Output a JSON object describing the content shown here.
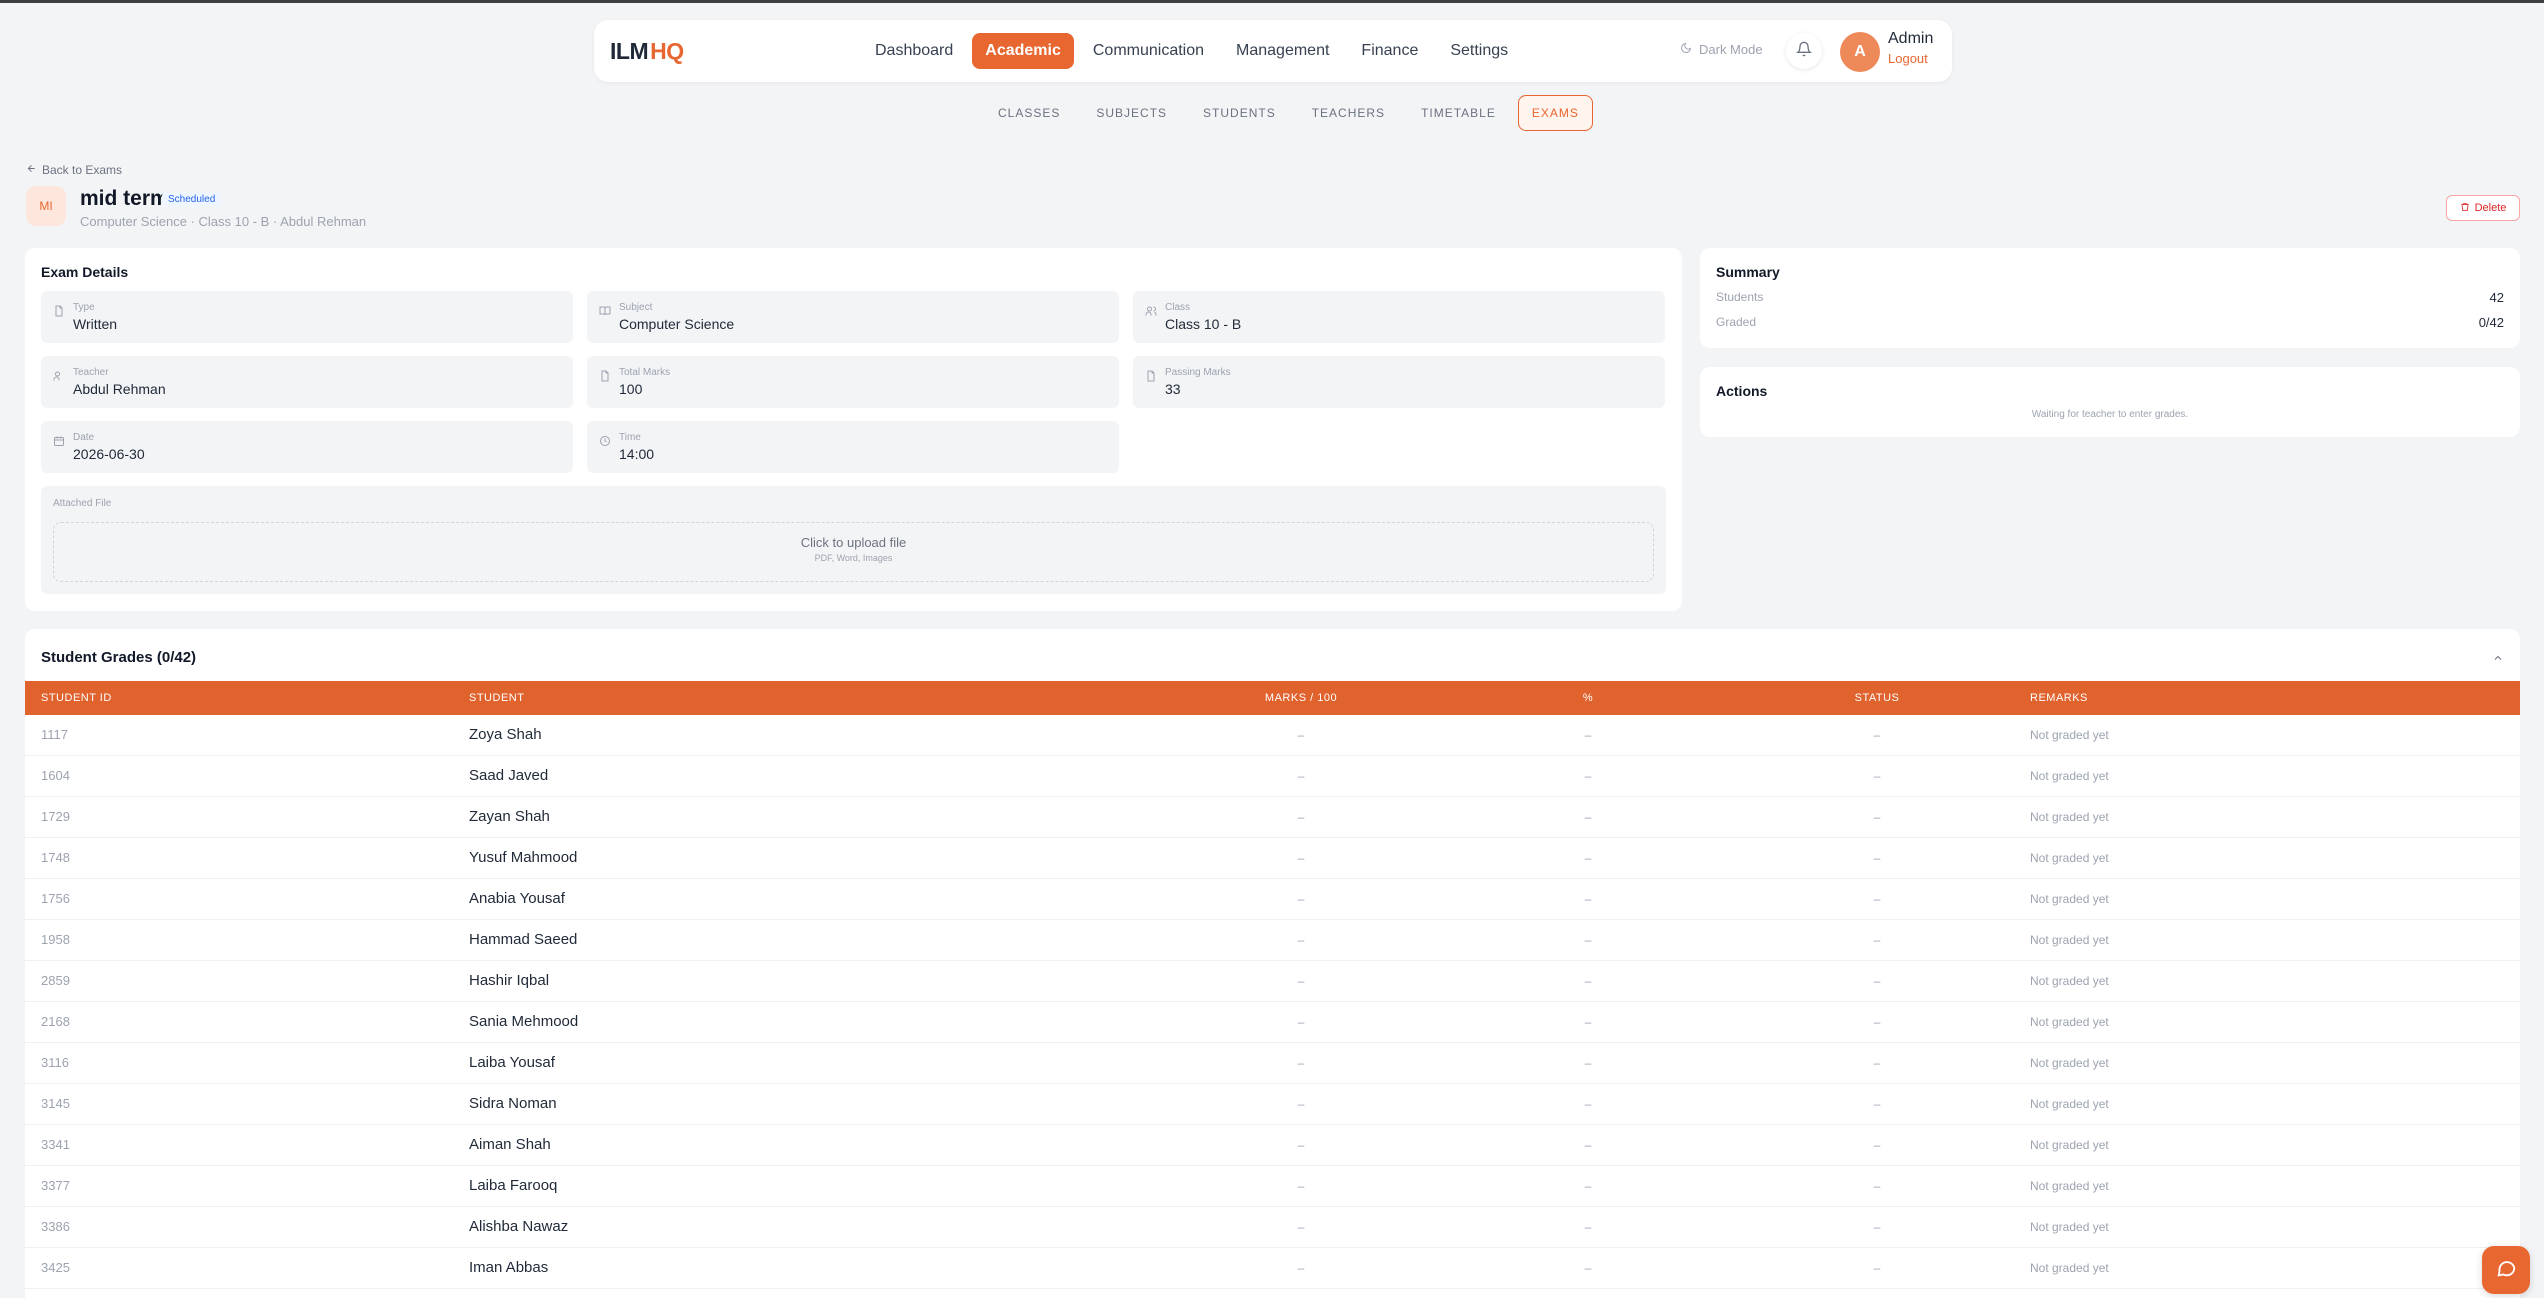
{
  "brand": {
    "name": "ILM",
    "suffix": "HQ"
  },
  "nav": {
    "items": [
      {
        "label": "Dashboard",
        "active": false
      },
      {
        "label": "Academic",
        "active": true
      },
      {
        "label": "Communication",
        "active": false
      },
      {
        "label": "Management",
        "active": false
      },
      {
        "label": "Finance",
        "active": false
      },
      {
        "label": "Settings",
        "active": false
      }
    ],
    "dark_mode": "Dark Mode",
    "bell_icon": "bell-icon",
    "user": {
      "initial": "A",
      "name": "Admin",
      "logout": "Logout"
    }
  },
  "subnav": {
    "items": [
      {
        "label": "CLASSES",
        "active": false
      },
      {
        "label": "SUBJECTS",
        "active": false
      },
      {
        "label": "STUDENTS",
        "active": false
      },
      {
        "label": "TEACHERS",
        "active": false
      },
      {
        "label": "TIMETABLE",
        "active": false
      },
      {
        "label": "EXAMS",
        "active": true
      }
    ]
  },
  "exam": {
    "back": "Back to Exams",
    "badge": "MI",
    "title": "mid term",
    "status": "Scheduled",
    "subtitle": "Computer Science · Class 10 - B · Abdul Rehman",
    "delete": "Delete"
  },
  "details": {
    "title": "Exam Details",
    "fields": [
      {
        "label": "Type",
        "value": "Written",
        "icon": "file-icon"
      },
      {
        "label": "Subject",
        "value": "Computer Science",
        "icon": "book-icon"
      },
      {
        "label": "Class",
        "value": "Class 10 - B",
        "icon": "users-icon"
      },
      {
        "label": "Teacher",
        "value": "Abdul Rehman",
        "icon": "user-icon"
      },
      {
        "label": "Total Marks",
        "value": "100",
        "icon": "file-icon"
      },
      {
        "label": "Passing Marks",
        "value": "33",
        "icon": "file-icon"
      },
      {
        "label": "Date",
        "value": "2026-06-30",
        "icon": "calendar-icon"
      },
      {
        "label": "Time",
        "value": "14:00",
        "icon": "clock-icon"
      }
    ],
    "attached_label": "Attached File",
    "upload_text": "Click to upload file",
    "upload_hint": "PDF, Word, Images"
  },
  "summary": {
    "title": "Summary",
    "students_label": "Students",
    "students_value": "42",
    "graded_label": "Graded",
    "graded_value": "0/42"
  },
  "actions": {
    "title": "Actions",
    "message": "Waiting for teacher to enter grades."
  },
  "grades": {
    "title": "Student Grades (0/42)",
    "columns": [
      "STUDENT ID",
      "STUDENT",
      "MARKS / 100",
      "%",
      "STATUS",
      "REMARKS"
    ],
    "rows": [
      {
        "id": "1117",
        "name": "Zoya Shah",
        "marks": "–",
        "pct": "–",
        "status": "–",
        "remarks": "Not graded yet"
      },
      {
        "id": "1604",
        "name": "Saad Javed",
        "marks": "–",
        "pct": "–",
        "status": "–",
        "remarks": "Not graded yet"
      },
      {
        "id": "1729",
        "name": "Zayan Shah",
        "marks": "–",
        "pct": "–",
        "status": "–",
        "remarks": "Not graded yet"
      },
      {
        "id": "1748",
        "name": "Yusuf Mahmood",
        "marks": "–",
        "pct": "–",
        "status": "–",
        "remarks": "Not graded yet"
      },
      {
        "id": "1756",
        "name": "Anabia Yousaf",
        "marks": "–",
        "pct": "–",
        "status": "–",
        "remarks": "Not graded yet"
      },
      {
        "id": "1958",
        "name": "Hammad Saeed",
        "marks": "–",
        "pct": "–",
        "status": "–",
        "remarks": "Not graded yet"
      },
      {
        "id": "2859",
        "name": "Hashir Iqbal",
        "marks": "–",
        "pct": "–",
        "status": "–",
        "remarks": "Not graded yet"
      },
      {
        "id": "2168",
        "name": "Sania Mehmood",
        "marks": "–",
        "pct": "–",
        "status": "–",
        "remarks": "Not graded yet"
      },
      {
        "id": "3116",
        "name": "Laiba Yousaf",
        "marks": "–",
        "pct": "–",
        "status": "–",
        "remarks": "Not graded yet"
      },
      {
        "id": "3145",
        "name": "Sidra Noman",
        "marks": "–",
        "pct": "–",
        "status": "–",
        "remarks": "Not graded yet"
      },
      {
        "id": "3341",
        "name": "Aiman Shah",
        "marks": "–",
        "pct": "–",
        "status": "–",
        "remarks": "Not graded yet"
      },
      {
        "id": "3377",
        "name": "Laiba Farooq",
        "marks": "–",
        "pct": "–",
        "status": "–",
        "remarks": "Not graded yet"
      },
      {
        "id": "3386",
        "name": "Alishba Nawaz",
        "marks": "–",
        "pct": "–",
        "status": "–",
        "remarks": "Not graded yet"
      },
      {
        "id": "3425",
        "name": "Iman Abbas",
        "marks": "–",
        "pct": "–",
        "status": "–",
        "remarks": "Not graded yet"
      }
    ]
  },
  "colors": {
    "accent": "#e8662f",
    "table_header": "#e0622d",
    "status_blue": "#2563eb",
    "danger": "#dc2626"
  },
  "chat_icon": "chat-bubble-icon"
}
